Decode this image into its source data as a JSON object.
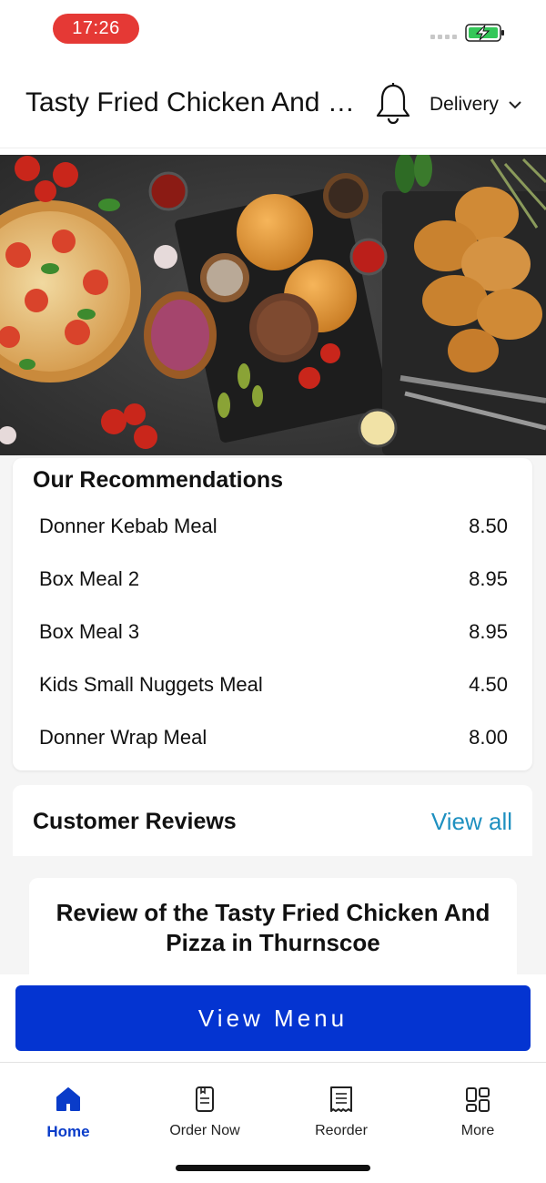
{
  "status_bar": {
    "time": "17:26",
    "battery_icon": "battery-charging-icon"
  },
  "header": {
    "store_name": "Tasty Fried Chicken And Pizza in Thurnscoe",
    "notification_icon": "bell-icon",
    "order_mode": "Delivery"
  },
  "hero": {
    "image": "food-banner-image"
  },
  "recommendations": {
    "title": "Our Recommendations",
    "items": [
      {
        "name": "Donner Kebab Meal",
        "price": "8.50"
      },
      {
        "name": "Box Meal 2",
        "price": "8.95"
      },
      {
        "name": "Box Meal 3",
        "price": "8.95"
      },
      {
        "name": "Kids Small Nuggets Meal",
        "price": "4.50"
      },
      {
        "name": "Donner Wrap Meal",
        "price": "8.00"
      }
    ]
  },
  "reviews": {
    "title": "Customer Reviews",
    "view_all": "View all",
    "card_title": "Review of the Tasty Fried Chicken And Pizza in Thurnscoe"
  },
  "cta": {
    "view_menu": "View Menu"
  },
  "tabs": [
    {
      "label": "Home",
      "icon": "home-icon",
      "active": true
    },
    {
      "label": "Order Now",
      "icon": "order-icon",
      "active": false
    },
    {
      "label": "Reorder",
      "icon": "receipt-icon",
      "active": false
    },
    {
      "label": "More",
      "icon": "grid-icon",
      "active": false
    }
  ],
  "colors": {
    "accent": "#0434d1",
    "link": "#1e90c0",
    "status_pill": "#e53935"
  }
}
